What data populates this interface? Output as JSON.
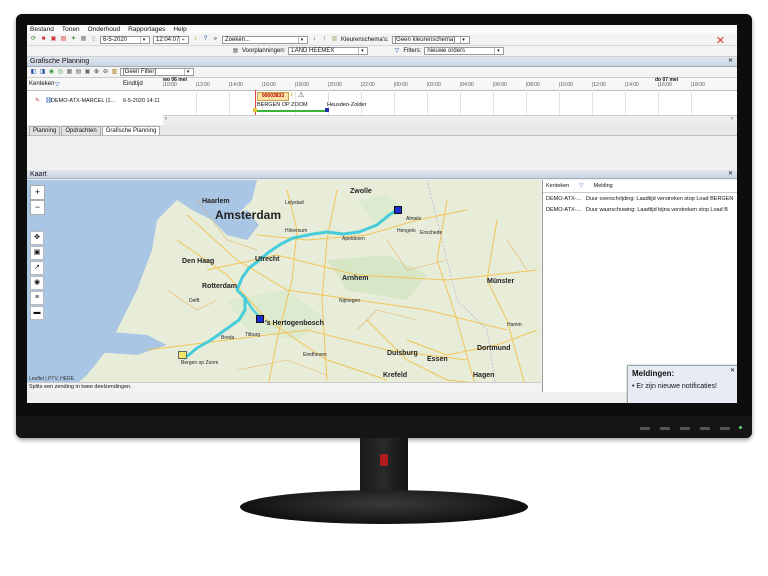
{
  "menu": [
    "Bestand",
    "Tonen",
    "Onderhoud",
    "Rapportages",
    "Help"
  ],
  "toolbar": {
    "date": "6-5-2020",
    "time": "12:04:07",
    "search_placeholder": "Zoeken...",
    "color_scheme_label": "Kleurenschema's:",
    "color_scheme_value": "[Geen kleurenschema]",
    "presets_label": "Voorplanningen:",
    "presets_value": "LAND HEEMEX",
    "filters_label": "Filters:",
    "filters_value": "nieuwe orders"
  },
  "grafische_planning": {
    "title": "Grafische Planning",
    "filter_value": "[Geen Filter]",
    "col_vehicle": "Kenteken",
    "col_end": "Eindtijd",
    "row_vehicle": "DEMO-ATX-MARCEL (1...",
    "row_end": "6-5-2020 14:11",
    "day1": "wo 06 mei",
    "day2": "do 07 mei",
    "ticks": [
      "|10:00",
      "|12:00",
      "|14:00",
      "|16:00",
      "|18:00",
      "|20:00",
      "|22:00",
      "|00:00",
      "|02:00",
      "|04:00",
      "|06:00",
      "|08:00",
      "|10:00",
      "|12:00",
      "|14:00",
      "|16:00",
      "|18:00"
    ],
    "order_id": "00003833",
    "stop1": "BERGEN OP ZOOM",
    "stop2": "Heusden-Zolder"
  },
  "tabs": [
    "Planning",
    "Opdrachten",
    "Grafische Planning"
  ],
  "kaart": {
    "title": "Kaart",
    "zoom_in": "+",
    "zoom_out": "−",
    "attribution": "Leaflet | PTV, HERE",
    "cities": [
      "Amsterdam",
      "Den Haag",
      "Utrecht",
      "Rotterdam",
      "Arnhem",
      "Zwolle",
      "Haarlem",
      "Hilversum",
      "Apeldoorn",
      "Almelo",
      "Hengelo",
      "Enschede",
      "Breda",
      "'s Hertogenbosch",
      "Münster",
      "Dortmund",
      "Essen",
      "Duisburg",
      "Krefeld",
      "Hagen",
      "Hamm",
      "Bergen op Zoom",
      "Lelystad",
      "Delft",
      "Nijmegen",
      "Tilburg",
      "Eindhoven"
    ]
  },
  "notifications": {
    "col_vehicle": "Kenteken",
    "col_message": "Melding",
    "rows": [
      {
        "vehicle": "DEMO-ATX-...",
        "message": "Duur overschrijding: Laadtijd verstreken stop Load BERGEN"
      },
      {
        "vehicle": "DEMO-ATX-...",
        "message": "Duur waarschuwing: Laadtijd bijna verstreken stop Load B"
      }
    ]
  },
  "toast": {
    "title": "Meldingen:",
    "text": "• Er zijn nieuwe notificaties!"
  },
  "status": "Splits een zending in twee deelzendingen.",
  "colors": {
    "route": "#35c9d9",
    "accent": "#2255aa",
    "close": "#dd3333"
  }
}
